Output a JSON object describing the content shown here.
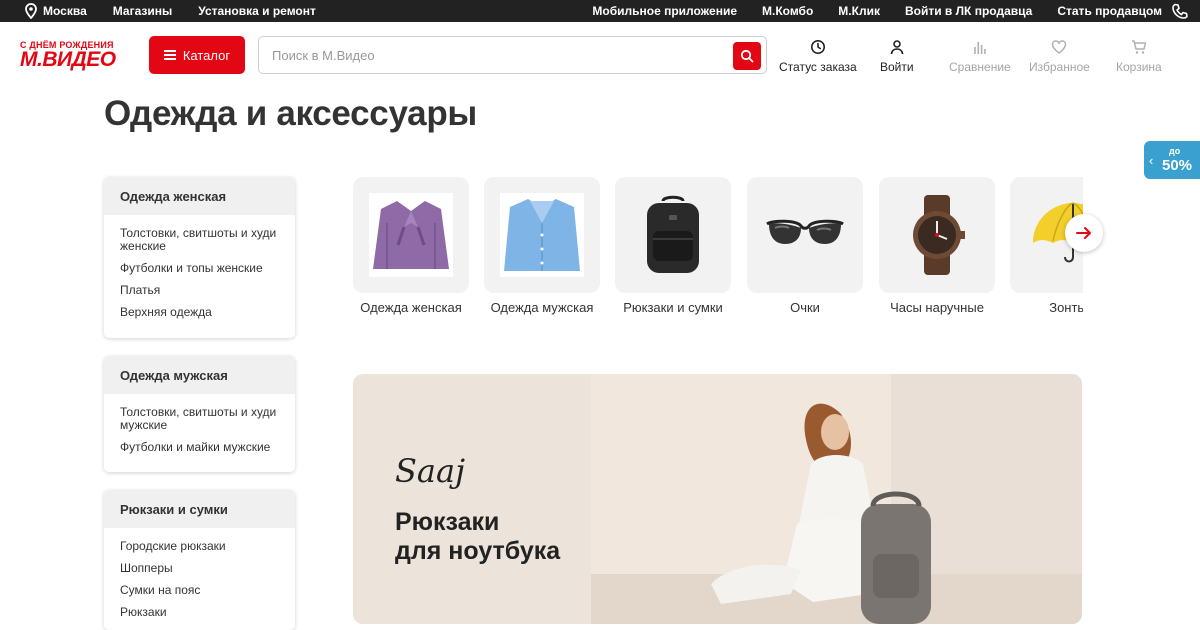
{
  "topbar": {
    "city": "Москва",
    "left_links": [
      "Магазины",
      "Установка и ремонт"
    ],
    "right_links": [
      "Мобильное приложение",
      "М.Комбо",
      "М.Клик",
      "Войти в ЛК продавца",
      "Стать продавцом"
    ]
  },
  "header": {
    "logo_line1": "С ДНЁМ РОЖДЕНИЯ",
    "logo_line2": "М.ВИДЕО",
    "catalog_label": "Каталог",
    "search_placeholder": "Поиск в М.Видео",
    "order_status": "Статус заказа",
    "login": "Войти",
    "compare": "Сравнение",
    "favorites": "Избранное",
    "cart": "Корзина"
  },
  "page_title": "Одежда и аксессуары",
  "promo_tab": {
    "line1": "до",
    "line2": "50%"
  },
  "sidebar": [
    {
      "title": "Одежда женская",
      "items": [
        "Толстовки, свитшоты и худи женские",
        "Футболки и топы женские",
        "Платья",
        "Верхняя одежда"
      ]
    },
    {
      "title": "Одежда мужская",
      "items": [
        "Толстовки, свитшоты и худи мужские",
        "Футболки и майки мужские"
      ]
    },
    {
      "title": "Рюкзаки и сумки",
      "items": [
        "Городские рюкзаки",
        "Шопперы",
        "Сумки на пояс",
        "Рюкзаки"
      ]
    }
  ],
  "categories": [
    {
      "label": "Одежда женская"
    },
    {
      "label": "Одежда мужская"
    },
    {
      "label": "Рюкзаки и сумки"
    },
    {
      "label": "Очки"
    },
    {
      "label": "Часы наручные"
    },
    {
      "label": "Зонты"
    }
  ],
  "banner": {
    "brand": "Saaj",
    "headline_line1": "Рюкзаки",
    "headline_line2": "для ноутбука"
  },
  "colors": {
    "brand_red": "#e30613",
    "promo_blue": "#3aa0d0",
    "topbar_bg": "#222222"
  }
}
